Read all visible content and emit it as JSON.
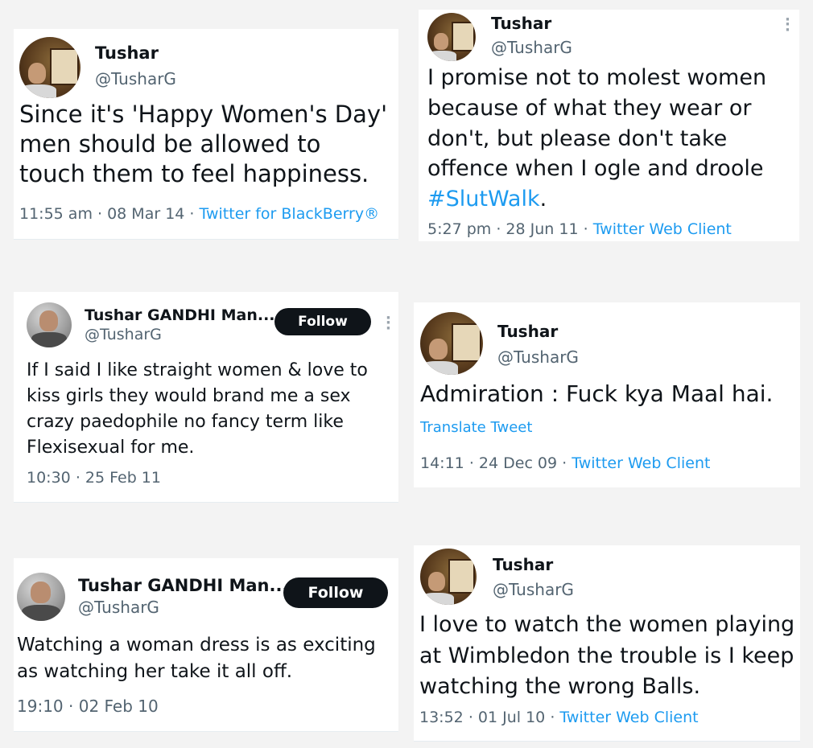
{
  "tweets": [
    {
      "name": "Tushar",
      "handle": "@TusharG",
      "text": "Since it's 'Happy Women's Day' men should be allowed to touch them to feel happiness.",
      "time": "11:55 am",
      "date": "08 Mar 14",
      "source": "Twitter for BlackBerry®"
    },
    {
      "name": "Tushar",
      "handle": "@TusharG",
      "text": "I promise not to molest women because of what they wear or don't, but please don't take offence when I ogle and droole",
      "hashtag": "#SlutWalk",
      "text_end": ".",
      "time": "5:27 pm",
      "date": "28 Jun 11",
      "source": "Twitter Web Client"
    },
    {
      "name": "Tushar GANDHI Man...",
      "handle": "@TusharG",
      "follow_label": "Follow",
      "text": "If I said I like straight women & love to kiss girls they would brand me a sex crazy paedophile no fancy term like Flexisexual for me.",
      "time": "10:30",
      "date": "25 Feb 11"
    },
    {
      "name": "Tushar",
      "handle": "@TusharG",
      "text": "Admiration : Fuck kya Maal hai.",
      "translate_label": "Translate Tweet",
      "time": "14:11",
      "date": "24 Dec 09",
      "source": "Twitter Web Client"
    },
    {
      "name": "Tushar GANDHI Man...",
      "handle": "@TusharG",
      "follow_label": "Follow",
      "text": "Watching a woman dress is as exciting as watching her take it all off.",
      "time": "19:10",
      "date": "02 Feb 10"
    },
    {
      "name": "Tushar",
      "handle": "@TusharG",
      "text": "I love to watch the women playing at Wimbledon the trouble is I keep watching the wrong Balls.",
      "time": "13:52",
      "date": "01 Jul 10",
      "source": "Twitter Web Client"
    }
  ],
  "separator": "·",
  "icons": {
    "more": "more-vertical-icon"
  },
  "colors": {
    "link": "#1d9bf0",
    "muted": "#536471",
    "text": "#0f1419",
    "button": "#0f1419"
  }
}
